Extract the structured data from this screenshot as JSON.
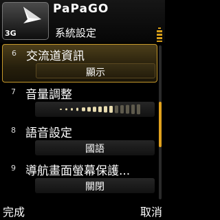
{
  "header": {
    "title": "PaPaGO",
    "subtitle": "系統設定",
    "signal": "3G"
  },
  "settings": [
    {
      "number": "6",
      "label": "交流道資訊",
      "value": "顯示",
      "selected": true
    },
    {
      "number": "7",
      "label": "音量調整",
      "volume_level": 10,
      "volume_max": 15
    },
    {
      "number": "8",
      "label": "語音設定",
      "value": "國語"
    },
    {
      "number": "9",
      "label": "導航畫面螢幕保護...",
      "value": "關閉"
    }
  ],
  "softkeys": {
    "left": "完成",
    "right": "取消"
  },
  "colors": {
    "accent": "#e0a11e",
    "selected_border": "#c79a2c",
    "background": "#000000"
  }
}
